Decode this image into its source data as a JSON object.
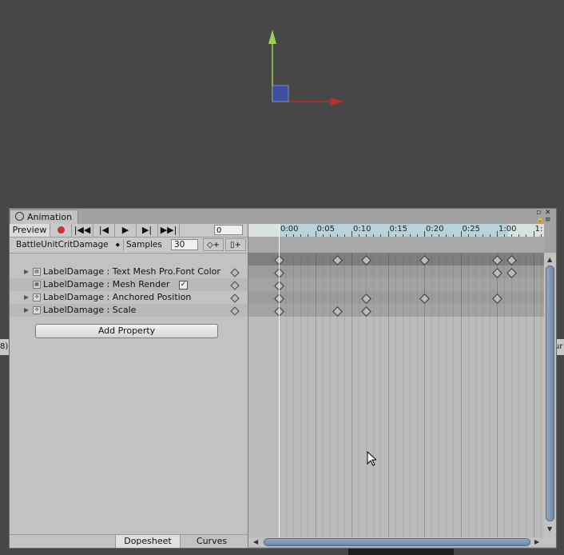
{
  "window": {
    "tab_label": "Animation",
    "controls": "▫ ✕"
  },
  "toolbar": {
    "preview_label": "Preview",
    "record_icon": "record-icon",
    "first_key_glyph": "⏮",
    "prev_key_glyph": "⏮",
    "play_glyph": "▶",
    "next_key_glyph": "⏭",
    "last_key_glyph": "⏭",
    "frame_value": "0"
  },
  "clip": {
    "name": "BattleUnitCritDamage",
    "samples_label": "Samples",
    "samples_value": "30",
    "add_key_glyph": "◇+",
    "add_event_glyph": "▯+"
  },
  "properties": [
    {
      "label": "LabelDamage : Text Mesh Pro.Font Color",
      "foldout": "▶",
      "icon": "text-mesh-icon"
    },
    {
      "label": "LabelDamage : Mesh Render",
      "foldout": "",
      "icon": "mesh-renderer-icon",
      "checked": true
    },
    {
      "label": "LabelDamage : Anchored Position",
      "foldout": "▶",
      "icon": "transform-icon"
    },
    {
      "label": "LabelDamage : Scale",
      "foldout": "▶",
      "icon": "transform-icon"
    }
  ],
  "add_property_label": "Add Property",
  "bottom_tabs": {
    "dopesheet_label": "Dopesheet",
    "curves_label": "Curves"
  },
  "ruler": {
    "labels": [
      "0:00",
      "0:05",
      "0:10",
      "0:15",
      "0:20",
      "0:25",
      "1:00",
      "1:"
    ]
  },
  "keyframes": {
    "summary": [
      0,
      8,
      12,
      20,
      30,
      32
    ],
    "font_color": [
      0,
      30,
      32
    ],
    "mesh_render": [
      0
    ],
    "anchored_position": [
      0,
      12,
      20,
      30
    ],
    "scale": [
      0,
      8,
      12
    ]
  },
  "side": {
    "left_text": "8)",
    "right_text": "ur"
  },
  "colors": {
    "scene_bg": "#474747",
    "ruler_bg": "#b5d3d8",
    "record_red": "#c83232",
    "scroll_thumb": "#6b86a8",
    "gizmo_y": "#9ed15a",
    "gizmo_x": "#b8302a",
    "gizmo_z": "#3b4f9e"
  }
}
